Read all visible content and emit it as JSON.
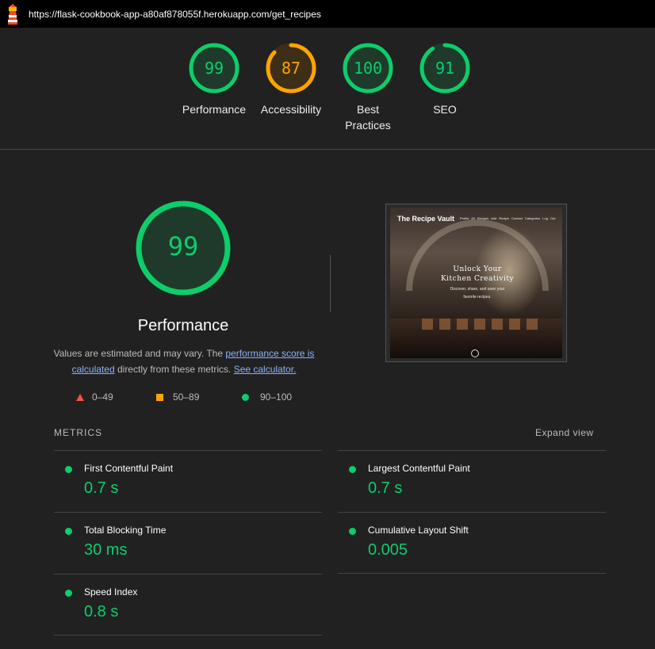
{
  "browser": {
    "url": "https://flask-cookbook-app-a80af878055f.herokuapp.com/get_recipes"
  },
  "colors": {
    "pass": "#0cce6b",
    "average": "#ffa400",
    "fail": "#ff4e42",
    "background": "#212121"
  },
  "categories": [
    {
      "label": "Performance",
      "score": "99",
      "score_value": 99,
      "rating": "pass"
    },
    {
      "label": "Accessibility",
      "score": "87",
      "score_value": 87,
      "rating": "average"
    },
    {
      "label_line1": "Best",
      "label_line2": "Practices",
      "score": "100",
      "score_value": 100,
      "rating": "pass"
    },
    {
      "label": "SEO",
      "score": "91",
      "score_value": 91,
      "rating": "pass"
    }
  ],
  "performance": {
    "score": "99",
    "score_value": 99,
    "title": "Performance",
    "desc_prefix": "Values are estimated and may vary. The ",
    "desc_link1": "performance score is calculated",
    "desc_middle": " directly from these metrics. ",
    "desc_link2": "See calculator."
  },
  "legend": [
    {
      "shape": "triangle",
      "range": "0–49"
    },
    {
      "shape": "square",
      "range": "50–89"
    },
    {
      "shape": "circle",
      "range": "90–100"
    }
  ],
  "screenshot": {
    "brand": "The Recipe Vault",
    "nav": "Profile  All Recipes  Add Recipe  Contact  Categories  Log Out",
    "heading_line1": "Unlock Your",
    "heading_line2": "Kitchen Creativity",
    "sub_line1": "Discover, share, and save your",
    "sub_line2": "favorite recipes."
  },
  "metrics": {
    "title": "METRICS",
    "expand_label": "Expand view",
    "items": [
      {
        "name": "First Contentful Paint",
        "value": "0.7 s"
      },
      {
        "name": "Largest Contentful Paint",
        "value": "0.7 s"
      },
      {
        "name": "Total Blocking Time",
        "value": "30 ms"
      },
      {
        "name": "Cumulative Layout Shift",
        "value": "0.005"
      },
      {
        "name": "Speed Index",
        "value": "0.8 s"
      }
    ]
  }
}
